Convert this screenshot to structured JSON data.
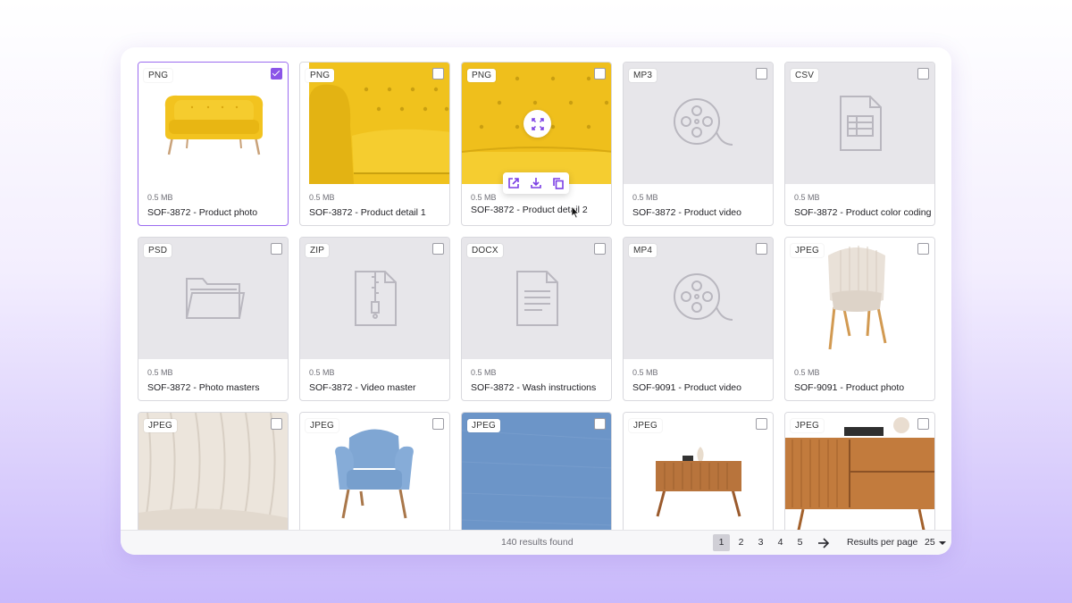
{
  "assets": [
    {
      "format": "PNG",
      "size": "0.5 MB",
      "title": "SOF-3872 - Product photo",
      "thumb": "yellow-sofa",
      "selected": true
    },
    {
      "format": "PNG",
      "size": "0.5 MB",
      "title": "SOF-3872 - Product detail 1",
      "thumb": "yellow-sofa-arm",
      "selected": false
    },
    {
      "format": "PNG",
      "size": "0.5 MB",
      "title": "SOF-3872 - Product detail 2",
      "thumb": "yellow-tufted",
      "selected": false
    },
    {
      "format": "MP3",
      "size": "0.5 MB",
      "title": "SOF-3872 - Product video",
      "thumb": "film-reel-icon",
      "selected": false
    },
    {
      "format": "CSV",
      "size": "0.5 MB",
      "title": "SOF-3872 - Product color coding",
      "thumb": "spreadsheet-icon",
      "selected": false
    },
    {
      "format": "PSD",
      "size": "0.5 MB",
      "title": "SOF-3872 - Photo masters",
      "thumb": "folder-icon",
      "selected": false
    },
    {
      "format": "ZIP",
      "size": "0.5 MB",
      "title": "SOF-3872 - Video master",
      "thumb": "zip-file-icon",
      "selected": false
    },
    {
      "format": "DOCX",
      "size": "0.5 MB",
      "title": "SOF-3872 - Wash instructions",
      "thumb": "document-icon",
      "selected": false
    },
    {
      "format": "MP4",
      "size": "0.5 MB",
      "title": "SOF-9091 - Product video",
      "thumb": "film-reel-icon",
      "selected": false
    },
    {
      "format": "JPEG",
      "size": "0.5 MB",
      "title": "SOF-9091 - Product photo",
      "thumb": "beige-chair",
      "selected": false
    },
    {
      "format": "JPEG",
      "size": "",
      "title": "",
      "thumb": "cream-fabric",
      "selected": false
    },
    {
      "format": "JPEG",
      "size": "",
      "title": "",
      "thumb": "blue-armchair",
      "selected": false
    },
    {
      "format": "JPEG",
      "size": "",
      "title": "",
      "thumb": "blue-fabric",
      "selected": false
    },
    {
      "format": "JPEG",
      "size": "",
      "title": "",
      "thumb": "wood-console",
      "selected": false
    },
    {
      "format": "JPEG",
      "size": "",
      "title": "",
      "thumb": "wood-sideboard",
      "selected": false
    }
  ],
  "hover_tools": [
    "open-external-icon",
    "download-icon",
    "copy-icon"
  ],
  "footer": {
    "results_text": "140 results found",
    "pages": [
      "1",
      "2",
      "3",
      "4",
      "5"
    ],
    "active_page": "1",
    "results_per_page_label": "Results per page",
    "results_per_page_value": "25"
  },
  "colors": {
    "accent": "#8b55e8",
    "placeholder": "#e7e6ea",
    "yellow": "#f0c21d"
  }
}
